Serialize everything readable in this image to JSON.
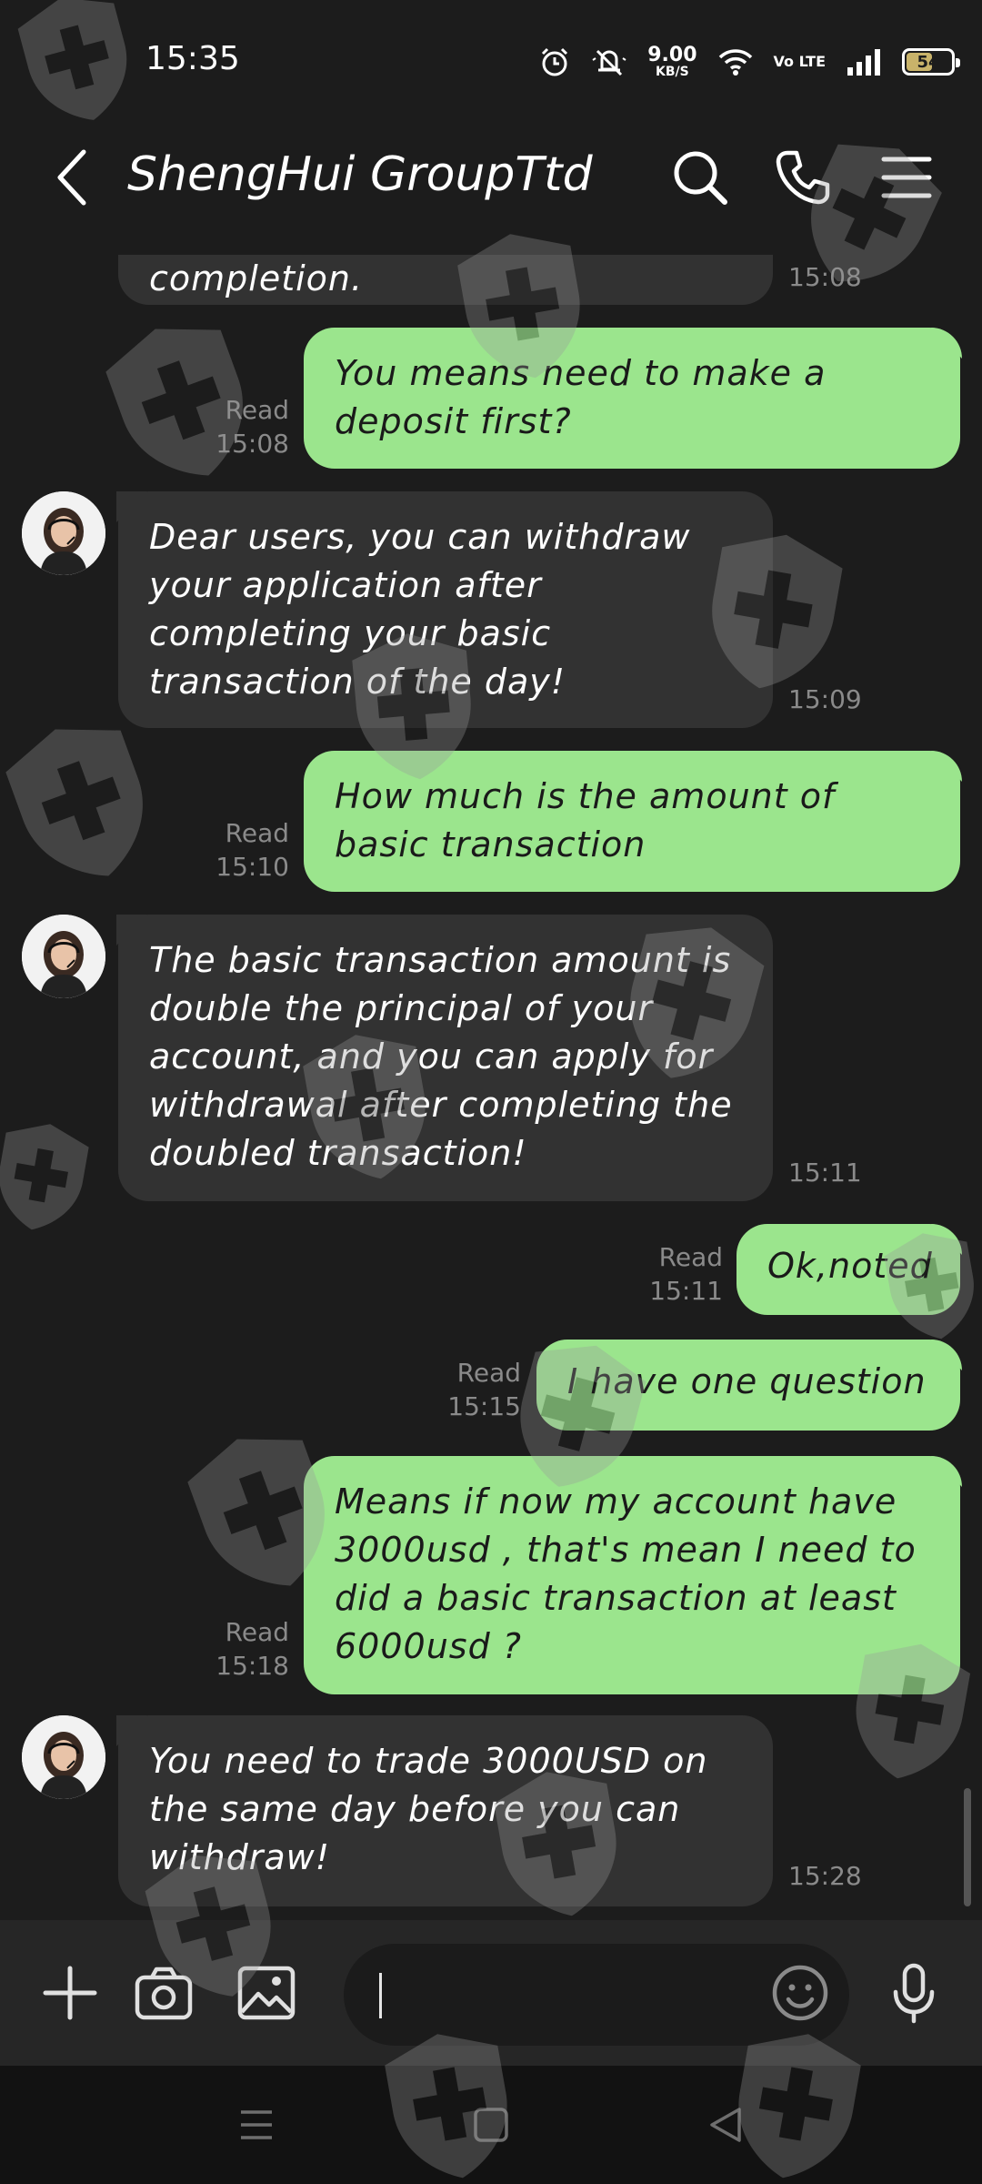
{
  "status_bar": {
    "time": "15:35",
    "net_speed_value": "9.00",
    "net_speed_unit": "KB/S",
    "volte": "Vo LTE",
    "battery": "54"
  },
  "header": {
    "title": "ShengHui GroupTtd",
    "icons": [
      "back-arrow-icon",
      "search-icon",
      "phone-icon",
      "hamburger-menu-icon"
    ]
  },
  "messages": [
    {
      "direction": "in",
      "text": "completion.",
      "time": "15:08"
    },
    {
      "direction": "out",
      "text": "You means need to make a deposit first?",
      "status": "Read",
      "time": "15:08"
    },
    {
      "direction": "in",
      "text": "Dear users, you can withdraw your application after completing your basic transaction of the day!",
      "time": "15:09"
    },
    {
      "direction": "out",
      "text": "How much is the amount of basic transaction",
      "status": "Read",
      "time": "15:10"
    },
    {
      "direction": "in",
      "text": "The basic transaction amount is double the principal of your account, and you can apply for withdrawal after completing the doubled transaction!",
      "time": "15:11"
    },
    {
      "direction": "out",
      "text": "Ok,noted",
      "status": "Read",
      "time": "15:11"
    },
    {
      "direction": "out",
      "text": "I have one question",
      "status": "Read",
      "time": "15:15"
    },
    {
      "direction": "out",
      "text": "Means if now my account have 3000usd , that's mean I need to did a basic transaction at least 6000usd ?",
      "status": "Read",
      "time": "15:18"
    },
    {
      "direction": "in",
      "text": "You need to trade 3000USD on the same day before you can withdraw!",
      "time": "15:28"
    }
  ],
  "composer": {
    "placeholder": "",
    "icons": [
      "plus-icon",
      "camera-icon",
      "image-icon",
      "emoji-icon",
      "microphone-icon"
    ]
  },
  "colors": {
    "background": "#1c1c1c",
    "incoming_bubble": "#323232",
    "outgoing_bubble": "#9be58d",
    "meta_text": "#8a8a8a"
  }
}
